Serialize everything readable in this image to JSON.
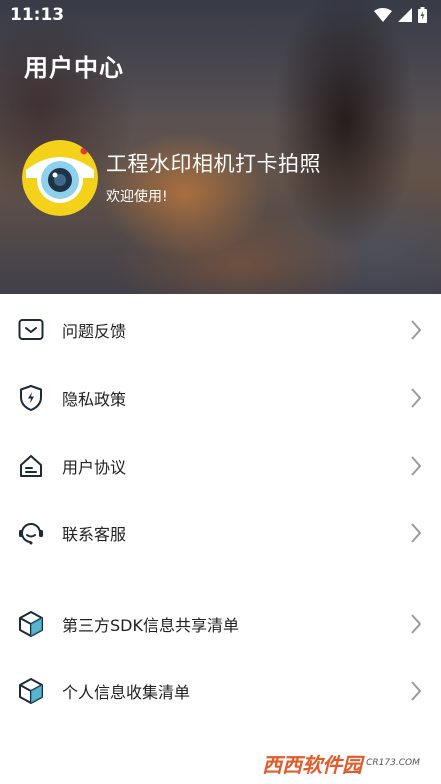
{
  "status_bar": {
    "time": "11:13"
  },
  "header": {
    "title": "用户中心",
    "app_name": "工程水印相机打卡拍照",
    "welcome": "欢迎使用!"
  },
  "menu": {
    "items": [
      {
        "label": "问题反馈",
        "icon": "feedback-icon"
      },
      {
        "label": "隐私政策",
        "icon": "shield-icon"
      },
      {
        "label": "用户协议",
        "icon": "agreement-icon"
      },
      {
        "label": "联系客服",
        "icon": "customer-service-icon"
      },
      {
        "label": "第三方SDK信息共享清单",
        "icon": "cube-icon"
      },
      {
        "label": "个人信息收集清单",
        "icon": "cube-icon"
      }
    ]
  },
  "watermark": {
    "main": "西西软件园",
    "sub": "CR173.COM"
  },
  "colors": {
    "accent": "#e45b2a",
    "avatar_yellow": "#f5d21a",
    "text": "#222222"
  }
}
